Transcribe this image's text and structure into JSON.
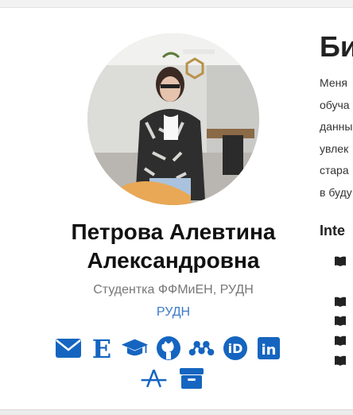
{
  "profile": {
    "name_line1": "Петрова Алевтина",
    "name_line2": "Александровна",
    "subtitle": "Студентка ФФМиЕН, РУДН",
    "organization": "РУДН"
  },
  "social_icons": [
    "envelope-icon",
    "e-library-icon",
    "graduation-cap-icon",
    "github-icon",
    "mendeley-icon",
    "orcid-icon",
    "linkedin-icon",
    "a-letter-icon",
    "archive-icon"
  ],
  "bio": {
    "heading": "Би",
    "lines": [
      "Меня",
      "обуча",
      "данны",
      "увлек",
      "стара",
      "в буду"
    ],
    "interests_heading": "Inte"
  },
  "colors": {
    "accent": "#1565c0",
    "link": "#3a7bc8"
  }
}
